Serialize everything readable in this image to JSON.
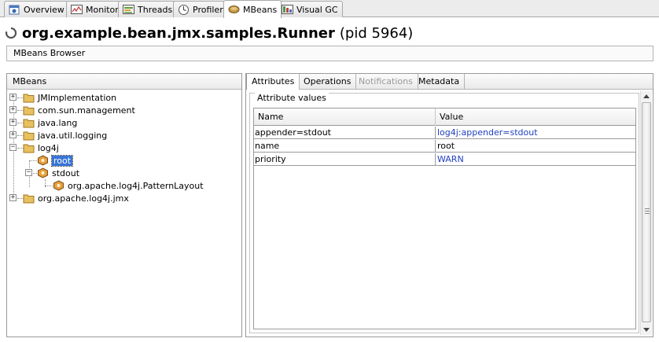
{
  "tabs": [
    {
      "label": "Overview",
      "icon": "overview-icon"
    },
    {
      "label": "Monitor",
      "icon": "monitor-icon"
    },
    {
      "label": "Threads",
      "icon": "threads-icon"
    },
    {
      "label": "Profiler",
      "icon": "profiler-icon"
    },
    {
      "label": "MBeans",
      "icon": "mbeans-icon",
      "active": true
    },
    {
      "label": "Visual GC",
      "icon": "visualgc-icon"
    }
  ],
  "header": {
    "title": "org.example.bean.jmx.samples.Runner",
    "pid": "(pid 5964)"
  },
  "subtitle": "MBeans Browser",
  "mbeans": {
    "header": "MBeans",
    "tree": [
      {
        "label": "JMImplementation"
      },
      {
        "label": "com.sun.management"
      },
      {
        "label": "java.lang"
      },
      {
        "label": "java.util.logging"
      },
      {
        "label": "log4j"
      },
      {
        "label": "root",
        "selected": true
      },
      {
        "label": "stdout"
      },
      {
        "label": "org.apache.log4j.PatternLayout"
      },
      {
        "label": "org.apache.log4j.jmx"
      }
    ]
  },
  "detail": {
    "tabs": [
      "Attributes",
      "Operations",
      "Notifications",
      "Metadata"
    ],
    "group_title": "Attribute values",
    "columns": [
      "Name",
      "Value"
    ],
    "rows": [
      {
        "name": "appender=stdout",
        "value": "log4j:appender=stdout"
      },
      {
        "name": "name",
        "value": "root"
      },
      {
        "name": "priority",
        "value": "WARN"
      }
    ]
  },
  "colors": {
    "selection": "#3875d7",
    "link": "#1f3fbf"
  }
}
